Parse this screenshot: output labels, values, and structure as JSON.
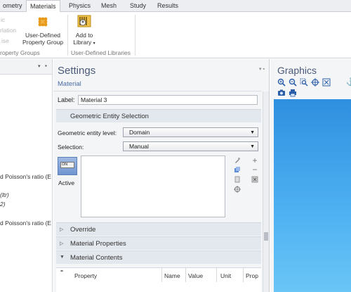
{
  "ribbon": {
    "tabs": [
      {
        "label": "ometry"
      },
      {
        "label": "Materials"
      },
      {
        "label": "Physics"
      },
      {
        "label": "Mesh"
      },
      {
        "label": "Study"
      },
      {
        "label": "Results"
      }
    ],
    "disabled_left": [
      "ic",
      "rlation",
      "ise"
    ],
    "group_left_label": "roperty Groups",
    "user_defined_btn": {
      "line1": "User-Defined",
      "line2": "Property Group"
    },
    "add_library_btn": {
      "line1": "Add to",
      "line2": "Library"
    },
    "group_right_label": "User-Defined Libraries"
  },
  "left_panel": {
    "lines": [
      {
        "text": "d Poisson's ratio (E",
        "italic": false
      },
      {
        "text": "(ltr)",
        "italic": true
      },
      {
        "text": "2)",
        "italic": true
      },
      {
        "text": "d Poisson's ratio (E",
        "italic": false
      }
    ]
  },
  "settings": {
    "title": "Settings",
    "subtitle": "Material",
    "pins": "▾ ▪",
    "label_caption": "Label:",
    "label_value": "Material 3",
    "geo_section": "Geometric Entity Selection",
    "geo_level_label": "Geometric entity level:",
    "geo_level_value": "Domain",
    "selection_label": "Selection:",
    "selection_value": "Manual",
    "active_label": "Active",
    "toggle_text": "ON",
    "sections": {
      "override": "Override",
      "material_properties": "Material Properties",
      "material_contents": "Material Contents"
    },
    "table": {
      "corner": "\"",
      "columns": [
        "Property",
        "Name",
        "Value",
        "Unit",
        "Prop"
      ]
    }
  },
  "graphics": {
    "title": "Graphics"
  }
}
